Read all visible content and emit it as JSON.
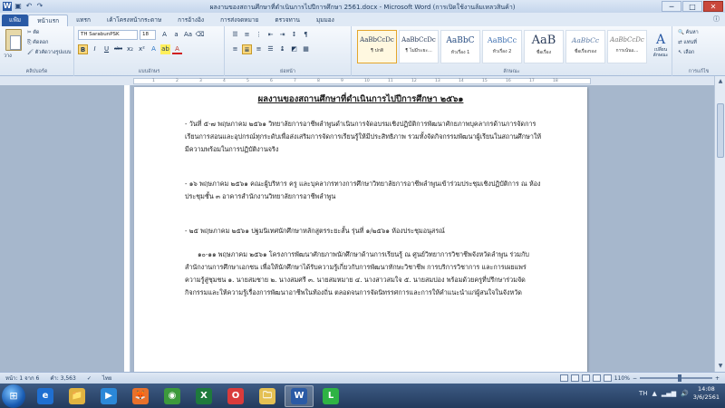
{
  "window": {
    "title": "ผลงานของสถานศึกษาที่ดำเนินการไปปีการศึกษา 2561.docx - Microsoft Word (การเปิดใช้งานล้มเหลวสินค้า)",
    "qat": [
      "save-icon",
      "undo-icon",
      "redo-icon"
    ],
    "controls": [
      "─",
      "□",
      "✕"
    ]
  },
  "tabs": [
    "แฟ้ม",
    "หน้าแรก",
    "แทรก",
    "เค้าโครงหน้ากระดาษ",
    "การอ้างอิง",
    "การส่งจดหมาย",
    "ตรวจทาน",
    "มุมมอง"
  ],
  "ribbon": {
    "clipboard": {
      "paste": "วาง",
      "cut": "ตัด",
      "copy": "คัดลอก",
      "format_painter": "ตัวคัดวางรูปแบบ",
      "label": "คลิปบอร์ด"
    },
    "font": {
      "name": "TH SarabunPSK",
      "size": "18",
      "label": "แบบอักษร",
      "buttons": [
        "B",
        "I",
        "U",
        "abc",
        "x₂",
        "x²",
        "A",
        "A"
      ]
    },
    "paragraph": {
      "label": "ย่อหน้า"
    },
    "styles": {
      "label": "ลักษณะ",
      "items": [
        {
          "sample": "AaBbCcDc",
          "name": "¶ ปกติ"
        },
        {
          "sample": "AaBbCcDc",
          "name": "¶ ไม่มีระยะ..."
        },
        {
          "sample": "AaBbC",
          "name": "หัวเรื่อง 1"
        },
        {
          "sample": "AaBbCc",
          "name": "หัวเรื่อง 2"
        },
        {
          "sample": "AaB",
          "name": "ชื่อเรื่อง"
        },
        {
          "sample": "AaBbCc",
          "name": "ชื่อเรื่องรอง"
        },
        {
          "sample": "AaBbCcDc",
          "name": "การเน้นแ..."
        }
      ],
      "change": "เปลี่ยน ลักษณะ"
    },
    "editing": {
      "find": "ค้นหา",
      "replace": "แทนที่",
      "select": "เลือก",
      "label": "การแก้ไข"
    }
  },
  "ruler": [
    "1",
    "2",
    "3",
    "4",
    "5",
    "6",
    "7",
    "8",
    "9",
    "10",
    "11",
    "12",
    "13",
    "14",
    "15",
    "16",
    "17",
    "18"
  ],
  "document": {
    "title": "ผลงานของสถานศึกษาที่ดำเนินการไปปีการศึกษา ๒๕๖๑",
    "paragraphs": [
      "- วันที่ ๕-๗ พฤษภาคม ๒๕๖๑ วิทยาลัยการอาชีพลำพูนดำเนินการจัดอบรมเชิงปฏิบัติการพัฒนาศักยภาพบุคลากรด้านการจัดการเรียนการสอนและอุปกรณ์ทุกระดับเพื่อส่งเสริมการจัดการเรียนรู้ให้มีประสิทธิภาพ รวมทั้งจัดกิจกรรมพัฒนาผู้เรียนในสถานศึกษาให้มีความพร้อมในการปฏิบัติงานจริง",
      "- ๑๖ พฤษภาคม ๒๕๖๑ คณะผู้บริหาร ครู และบุคลากรทางการศึกษาวิทยาลัยการอาชีพลำพูนเข้าร่วมประชุมเชิงปฏิบัติการ ณ ห้องประชุมชั้น ๓ อาคารสำนักงานวิทยาลัยการอาชีพลำพูน",
      "- ๒๕ พฤษภาคม ๒๕๖๑ ปฐมนิเทศนักศึกษาหลักสูตรระยะสั้น รุ่นที่ ๑/๒๕๖๑ ห้องประชุมอนุสรณ์",
      "๑๐-๑๑ พฤษภาคม ๒๕๖๑ โครงการพัฒนาศักยภาพนักศึกษาด้านการเรียนรู้ ณ ศูนย์วิทยาการวิชาชีพจังหวัดลำพูน ร่วมกับสำนักงานการศึกษาเอกชน เพื่อให้นักศึกษาได้รับความรู้เกี่ยวกับการพัฒนาทักษะวิชาชีพ การบริการวิชาการ และการเผยแพร่ความรู้สู่ชุมชน ๑. นายสมชาย ๒. นางสมศรี ๓. นายสมหมาย ๔. นางสาวสมใจ ๕. นายสมปอง พร้อมด้วยครูที่ปรึกษาร่วมจัดกิจกรรมและให้ความรู้เรื่องการพัฒนาอาชีพในท้องถิ่น ตลอดจนการจัดนิทรรศการและการให้คำแนะนำแก่ผู้สนใจในจังหวัด"
    ]
  },
  "status": {
    "page": "หน้า: 1 จาก 6",
    "words": "คำ: 3,563",
    "language": "ไทย",
    "zoom": "110%",
    "zoom_level": 0.55
  },
  "taskbar": {
    "apps": [
      {
        "icon": "ie-icon",
        "glyph": "e"
      },
      {
        "icon": "explorer-icon",
        "glyph": "📁"
      },
      {
        "icon": "media-player-icon",
        "glyph": "▶"
      },
      {
        "icon": "firefox-icon",
        "glyph": "🦊"
      },
      {
        "icon": "chrome-icon",
        "glyph": "◉"
      },
      {
        "icon": "excel-icon",
        "glyph": "X"
      },
      {
        "icon": "opera-icon",
        "glyph": "O"
      },
      {
        "icon": "folder-icon",
        "glyph": "🗀"
      },
      {
        "icon": "word-icon",
        "glyph": "W"
      },
      {
        "icon": "line-icon",
        "glyph": "L"
      }
    ],
    "language": "TH",
    "time": "14:08",
    "date": "3/6/2561"
  }
}
